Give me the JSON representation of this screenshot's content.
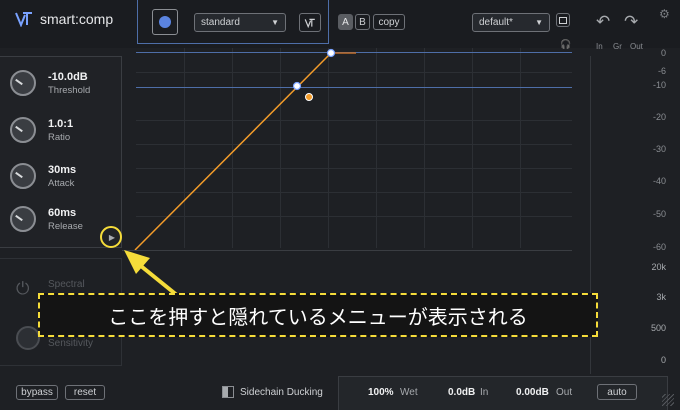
{
  "header": {
    "logo_text": "smart:comp",
    "preset_mode": "standard",
    "ab_a": "A",
    "ab_b": "B",
    "copy_label": "copy",
    "preset_name": "default*",
    "meter_labels": [
      "In",
      "Gr",
      "Out"
    ]
  },
  "left_panel": {
    "threshold": {
      "value": "-10.0dB",
      "label": "Threshold"
    },
    "ratio": {
      "value": "1.0:1",
      "label": "Ratio"
    },
    "attack": {
      "value": "30ms",
      "label": "Attack"
    },
    "release": {
      "value": "60ms",
      "label": "Release"
    },
    "spectral_label": "Spectral",
    "sensitivity_label": "Sensitivity"
  },
  "db_scale": [
    "0",
    "-6",
    "-10",
    "-20",
    "-30",
    "-40",
    "-50",
    "-60"
  ],
  "freq_scale": [
    "20k",
    "3k",
    "500",
    "0"
  ],
  "annotation": "ここを押すと隠れているメニューが表示される",
  "footer": {
    "bypass_label": "bypass",
    "reset_label": "reset",
    "sidechain_label": "Sidechain Ducking",
    "wet_value": "100%",
    "wet_label": "Wet",
    "in_value": "0.0dB",
    "in_label": "In",
    "out_value": "0.00dB",
    "out_label": "Out",
    "auto_label": "auto"
  },
  "colors": {
    "accent_orange": "#f39c2b",
    "accent_blue": "#7aa2ff",
    "annotation_yellow": "#f5dc3a"
  }
}
